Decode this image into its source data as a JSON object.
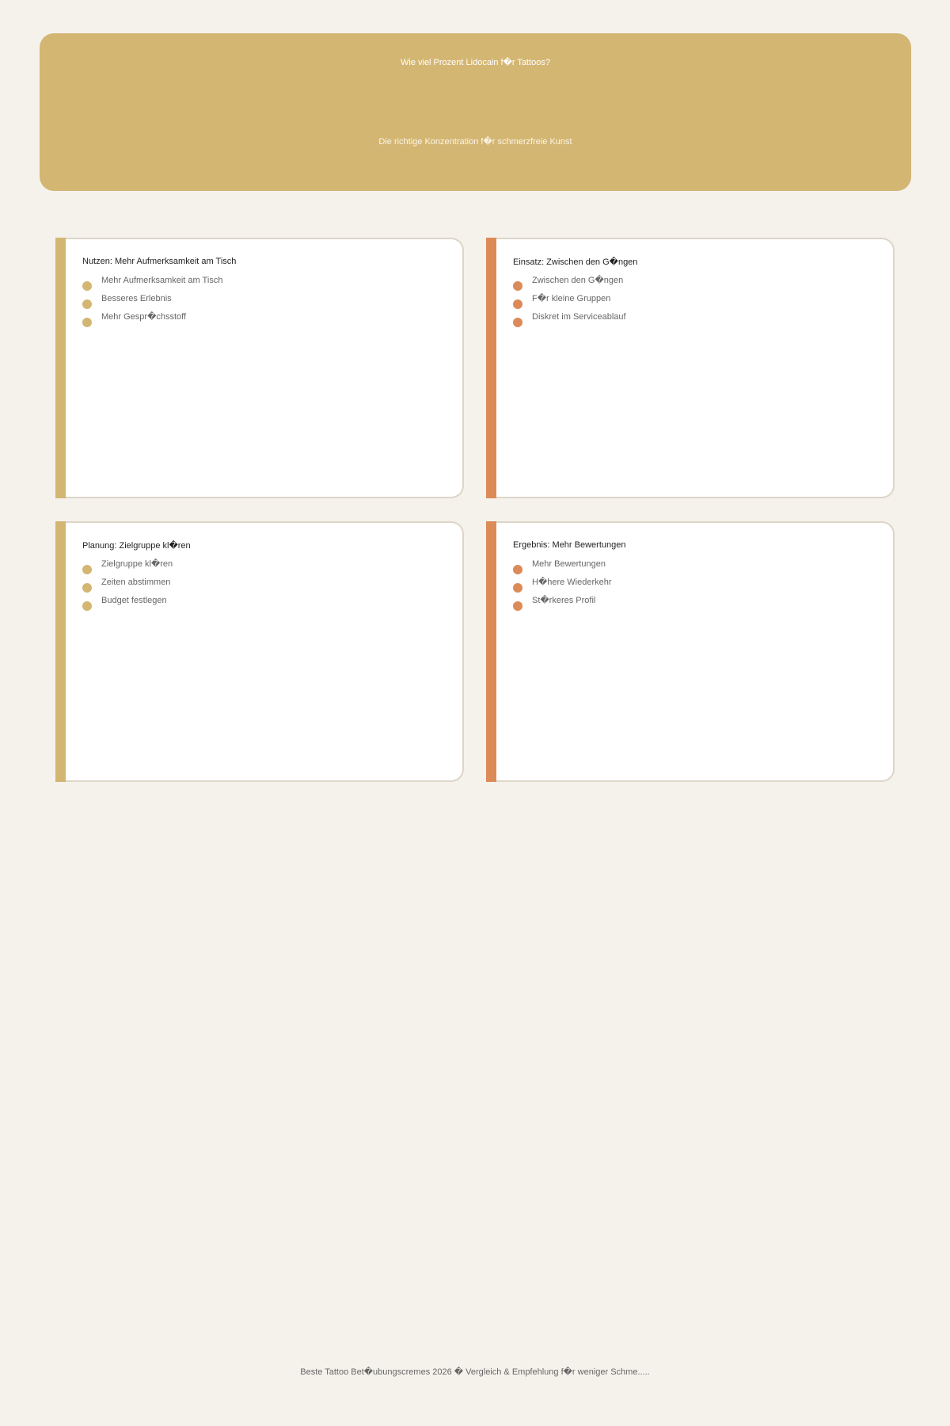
{
  "hero": {
    "title": "Wie viel Prozent Lidocain f�r Tattoos?",
    "subtitle": "Die richtige Konzentration f�r schmerzfreie Kunst"
  },
  "cards": [
    {
      "title": "Nutzen: Mehr Aufmerksamkeit am Tisch",
      "accent": "#d4b673",
      "items": [
        "Mehr Aufmerksamkeit am Tisch",
        "Besseres Erlebnis",
        "Mehr Gespr�chsstoff"
      ]
    },
    {
      "title": "Einsatz: Zwischen den G�ngen",
      "accent": "#dc8a58",
      "items": [
        "Zwischen den G�ngen",
        "F�r kleine Gruppen",
        "Diskret im Serviceablauf"
      ]
    },
    {
      "title": "Planung: Zielgruppe kl�ren",
      "accent": "#d4b673",
      "items": [
        "Zielgruppe kl�ren",
        "Zeiten abstimmen",
        "Budget festlegen"
      ]
    },
    {
      "title": "Ergebnis: Mehr Bewertungen",
      "accent": "#dc8a58",
      "items": [
        "Mehr Bewertungen",
        "H�here Wiederkehr",
        "St�rkeres Profil"
      ]
    }
  ],
  "footer": {
    "text": "Beste Tattoo Bet�ubungscremes 2026 � Vergleich & Empfehlung f�r weniger Schme....."
  }
}
